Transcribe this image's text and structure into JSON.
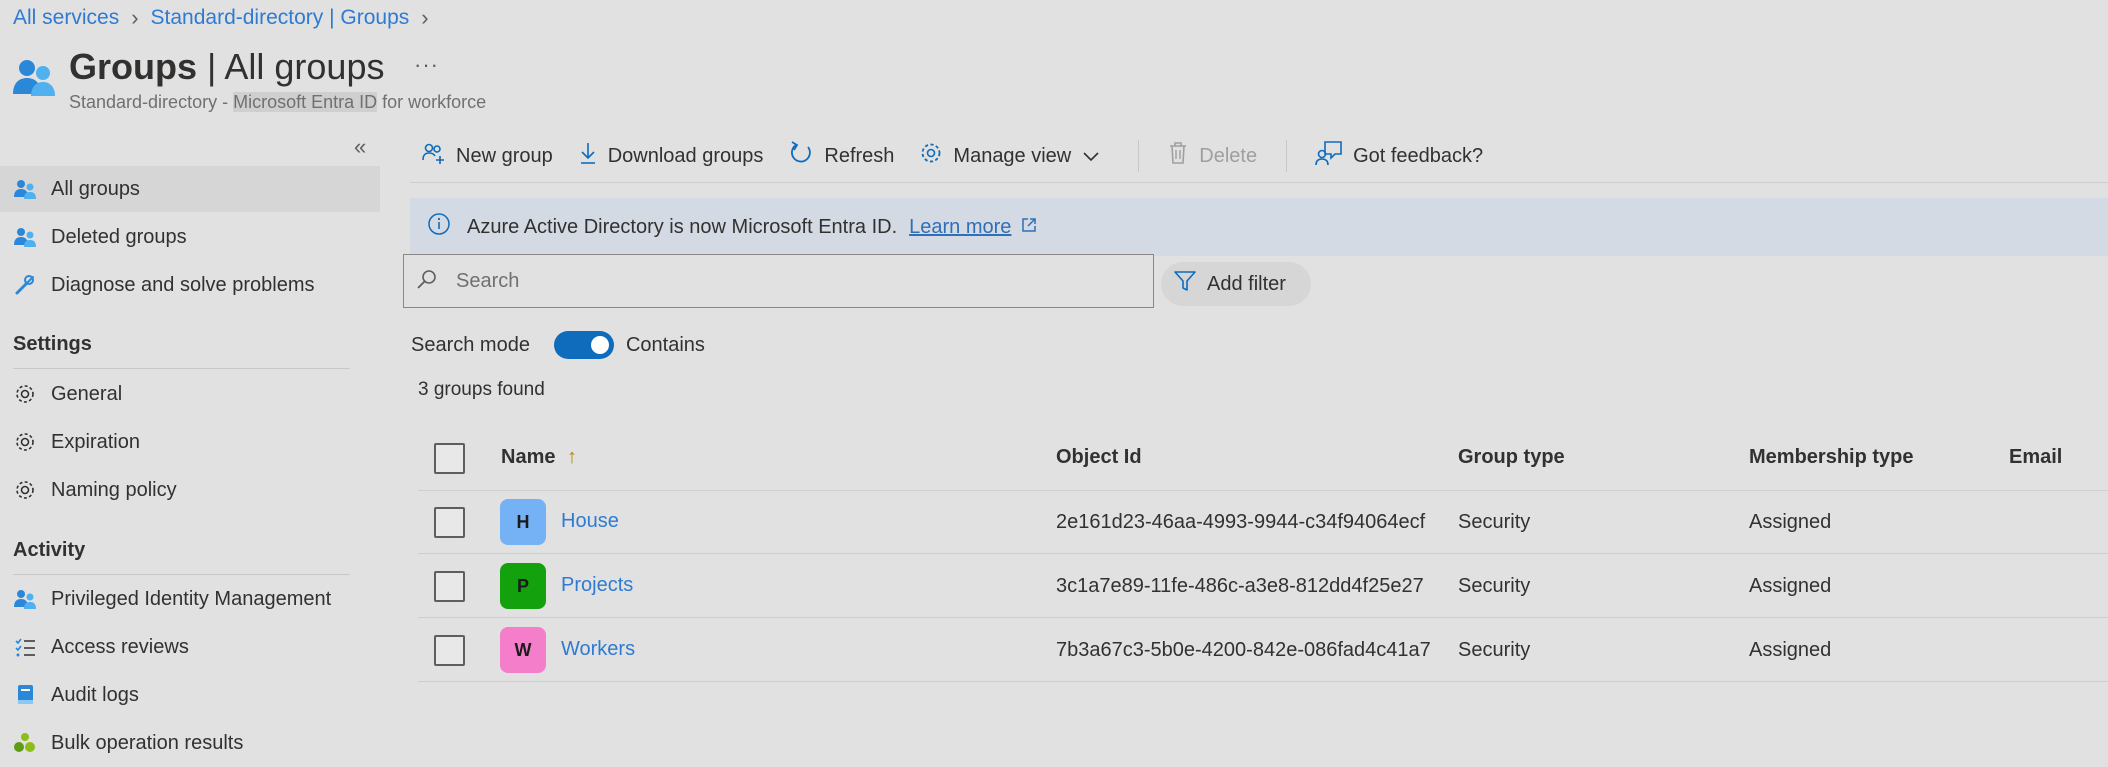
{
  "breadcrumb": {
    "items": [
      "All services",
      "Standard-directory | Groups"
    ]
  },
  "header": {
    "title_bold": "Groups",
    "title_rest": " | All groups",
    "more": "···",
    "subtitle_prefix": "Standard-directory - ",
    "subtitle_highlight": "Microsoft Entra ID",
    "subtitle_suffix": " for workforce"
  },
  "sidebar": {
    "collapse_glyph": "«",
    "items": [
      {
        "label": "All groups",
        "icon": "groups-icon"
      },
      {
        "label": "Deleted groups",
        "icon": "groups-icon"
      },
      {
        "label": "Diagnose and solve problems",
        "icon": "wrench-icon"
      }
    ],
    "settings_title": "Settings",
    "settings_items": [
      {
        "label": "General",
        "icon": "gear-icon"
      },
      {
        "label": "Expiration",
        "icon": "gear-icon"
      },
      {
        "label": "Naming policy",
        "icon": "gear-icon"
      }
    ],
    "activity_title": "Activity",
    "activity_items": [
      {
        "label": "Privileged Identity Management",
        "icon": "pim-icon"
      },
      {
        "label": "Access reviews",
        "icon": "checklist-icon"
      },
      {
        "label": "Audit logs",
        "icon": "book-icon"
      },
      {
        "label": "Bulk operation results",
        "icon": "bulk-icon"
      }
    ]
  },
  "toolbar": {
    "new_group": "New group",
    "download_groups": "Download groups",
    "refresh": "Refresh",
    "manage_view": "Manage view",
    "delete": "Delete",
    "feedback": "Got feedback?"
  },
  "banner": {
    "text": "Azure Active Directory is now Microsoft Entra ID.",
    "link": "Learn more"
  },
  "search": {
    "placeholder": "Search",
    "value": "",
    "add_filter": "Add filter",
    "mode_label": "Search mode",
    "mode_value": "Contains",
    "mode_on": true
  },
  "results": {
    "count_text": "3 groups found"
  },
  "table": {
    "headers": {
      "name": "Name",
      "sort": "↑",
      "object_id": "Object Id",
      "group_type": "Group type",
      "membership_type": "Membership type",
      "email": "Email"
    },
    "rows": [
      {
        "initial": "H",
        "name": "House",
        "object_id": "2e161d23-46aa-4993-9944-c34f94064ecf",
        "group_type": "Security",
        "membership_type": "Assigned",
        "color": "#74b2f5"
      },
      {
        "initial": "P",
        "name": "Projects",
        "object_id": "3c1a7e89-11fe-486c-a3e8-812dd4f25e27",
        "group_type": "Security",
        "membership_type": "Assigned",
        "color": "#13a10e"
      },
      {
        "initial": "W",
        "name": "Workers",
        "object_id": "7b3a67c3-5b0e-4200-842e-086fad4c41a7",
        "group_type": "Security",
        "membership_type": "Assigned",
        "color": "#f57ecb"
      }
    ]
  },
  "colors": {
    "accent": "#0f6cbd",
    "link": "#2f7bd3",
    "background": "#e1e1e1"
  }
}
